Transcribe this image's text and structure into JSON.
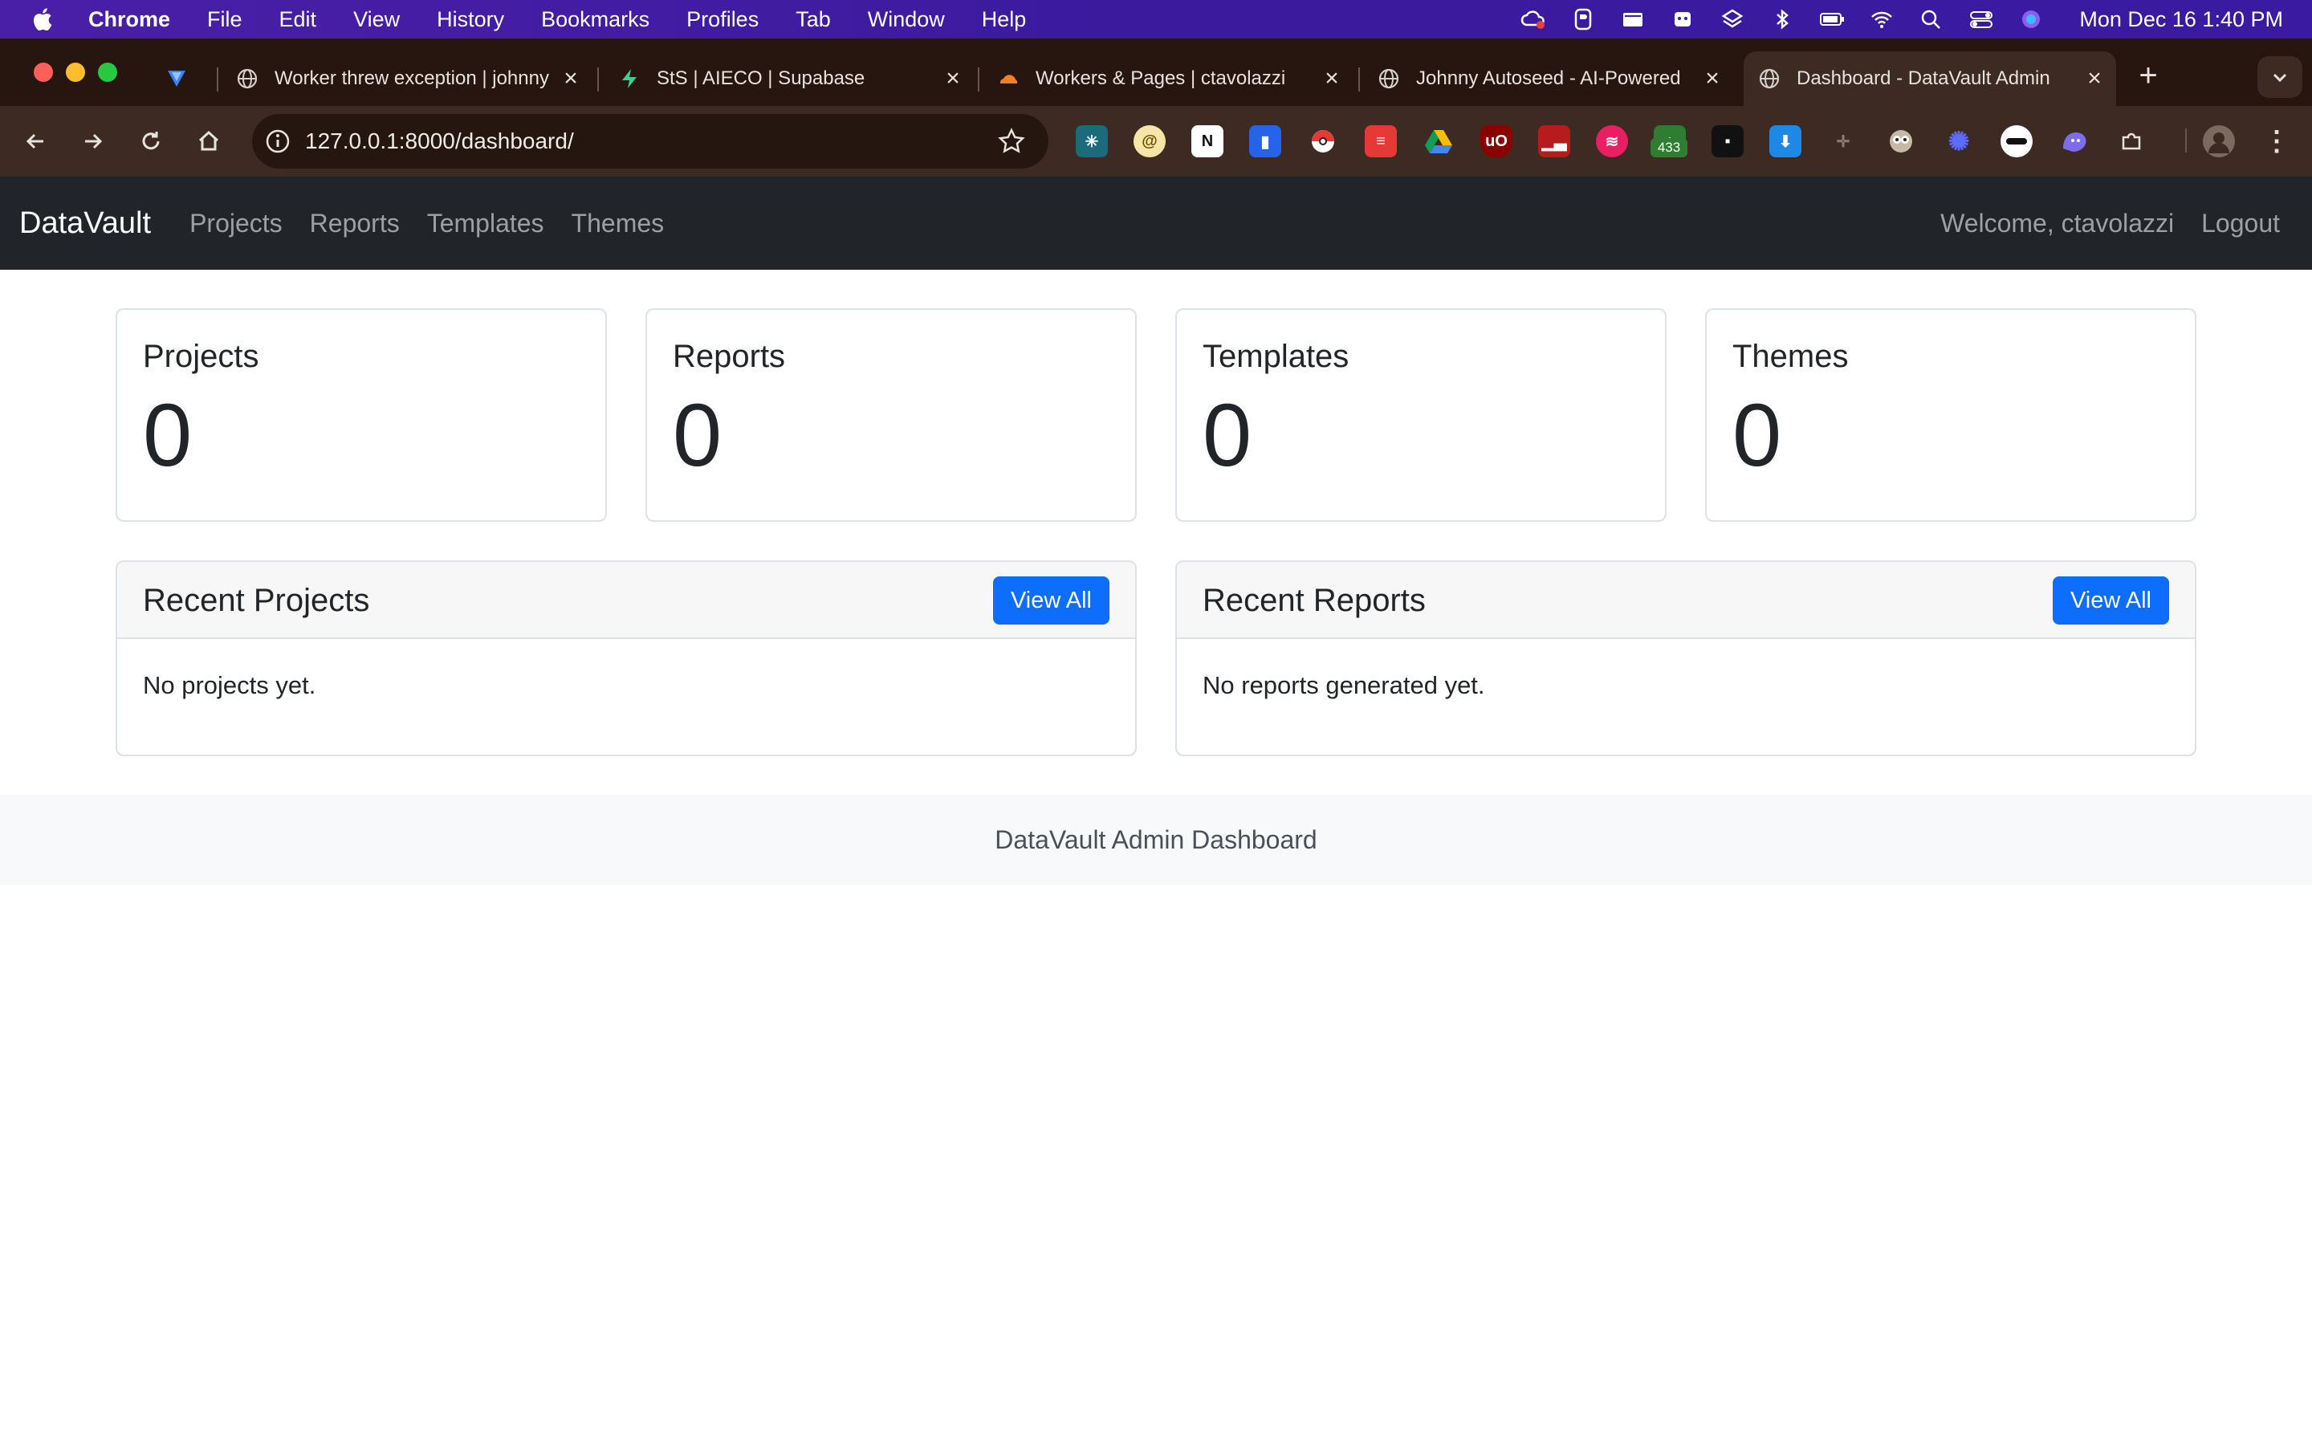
{
  "menubar": {
    "app_name": "Chrome",
    "items": [
      "File",
      "Edit",
      "View",
      "History",
      "Bookmarks",
      "Profiles",
      "Tab",
      "Window",
      "Help"
    ],
    "clock": "Mon Dec 16  1:40 PM"
  },
  "tabs": [
    {
      "title": "",
      "icon": "vpn-shield-icon"
    },
    {
      "title": "Worker threw exception | johnny",
      "icon": "globe-icon"
    },
    {
      "title": "StS | AIECO | Supabase",
      "icon": "supabase-icon"
    },
    {
      "title": "Workers & Pages | ctavolazzi",
      "icon": "cloudflare-icon"
    },
    {
      "title": "Johnny Autoseed - AI-Powered",
      "icon": "globe-icon"
    },
    {
      "title": "Dashboard - DataVault Admin",
      "icon": "globe-icon",
      "active": true
    }
  ],
  "toolbar": {
    "url": "127.0.0.1:8000/dashboard/",
    "extension_badge": "433"
  },
  "navbar": {
    "brand": "DataVault",
    "links": [
      "Projects",
      "Reports",
      "Templates",
      "Themes"
    ],
    "welcome": "Welcome, ctavolazzi",
    "logout": "Logout"
  },
  "stats": [
    {
      "label": "Projects",
      "value": "0"
    },
    {
      "label": "Reports",
      "value": "0"
    },
    {
      "label": "Templates",
      "value": "0"
    },
    {
      "label": "Themes",
      "value": "0"
    }
  ],
  "recent_projects": {
    "title": "Recent Projects",
    "button": "View All",
    "empty": "No projects yet."
  },
  "recent_reports": {
    "title": "Recent Reports",
    "button": "View All",
    "empty": "No reports generated yet."
  },
  "footer": "DataVault Admin Dashboard",
  "colors": {
    "primary": "#0d6efd",
    "navbar": "#212529",
    "menubar": "#3b1a9e",
    "tabstrip": "#271510"
  }
}
